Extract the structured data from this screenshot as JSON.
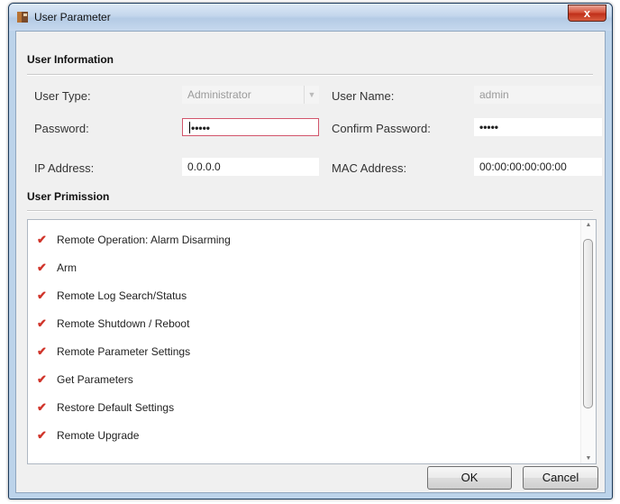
{
  "window": {
    "title": "User Parameter",
    "close_glyph": "x"
  },
  "user_information": {
    "section_title": "User Information",
    "user_type": {
      "label": "User Type:",
      "value": "Administrator"
    },
    "user_name": {
      "label": "User Name:",
      "value": "admin"
    },
    "password": {
      "label": "Password:",
      "value": "•••••"
    },
    "confirm_password": {
      "label": "Confirm Password:",
      "value": "•••••"
    },
    "ip_address": {
      "label": "IP Address:",
      "value": "0.0.0.0"
    },
    "mac_address": {
      "label": "MAC Address:",
      "value": "00:00:00:00:00:00"
    }
  },
  "user_permission": {
    "section_title": "User Primission",
    "check_glyph": "✔",
    "items": [
      {
        "label": "Remote Operation: Alarm Disarming",
        "checked": true
      },
      {
        "label": "Arm",
        "checked": true
      },
      {
        "label": "Remote Log Search/Status",
        "checked": true
      },
      {
        "label": "Remote Shutdown / Reboot",
        "checked": true
      },
      {
        "label": "Remote Parameter Settings",
        "checked": true
      },
      {
        "label": "Get Parameters",
        "checked": true
      },
      {
        "label": "Restore Default Settings",
        "checked": true
      },
      {
        "label": "Remote Upgrade",
        "checked": true
      }
    ]
  },
  "buttons": {
    "ok": "OK",
    "cancel": "Cancel"
  },
  "colors": {
    "check": "#d0342a",
    "active_border": "#d2556b",
    "close_button": "#c0301a"
  }
}
